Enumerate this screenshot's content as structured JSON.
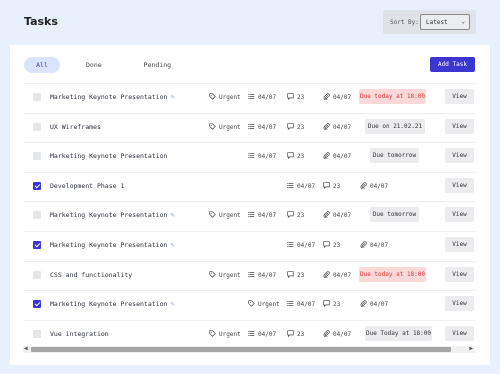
{
  "header": {
    "title": "Tasks",
    "sort_label": "Sort By:",
    "sort_value": "Latest"
  },
  "tabs": [
    {
      "label": "All",
      "active": true
    },
    {
      "label": "Done",
      "active": false
    },
    {
      "label": "Pending",
      "active": false
    }
  ],
  "add_button": "Add Task",
  "view_label": "View",
  "rows": [
    {
      "title": "Marketing Keynote Presentation",
      "edit": true,
      "checked": false,
      "tag": "Urgent",
      "date": "04/07",
      "comments": "23",
      "attach_date": "04/07",
      "status": "Due today at 18:00",
      "status_type": "red",
      "layout": "a"
    },
    {
      "title": "UX Wireframes",
      "edit": false,
      "checked": false,
      "tag": "Urgent",
      "date": "04/07",
      "comments": "23",
      "attach_date": "04/07",
      "status": "Due on 21.02.21",
      "status_type": "gray",
      "layout": "a"
    },
    {
      "title": "Marketing Keynote Presentation",
      "edit": false,
      "checked": false,
      "tag": "",
      "date": "04/07",
      "comments": "23",
      "attach_date": "04/07",
      "status": "Due tomorrow",
      "status_type": "gray",
      "layout": "a"
    },
    {
      "title": "Development Phase 1",
      "edit": false,
      "checked": true,
      "tag": "",
      "date": "04/07",
      "comments": "23",
      "attach_date": "04/07",
      "status": "",
      "status_type": "",
      "layout": "b"
    },
    {
      "title": "Marketing Keynote Presentation",
      "edit": true,
      "checked": false,
      "tag": "Urgent",
      "date": "04/07",
      "comments": "23",
      "attach_date": "04/07",
      "status": "Due tomorrow",
      "status_type": "gray",
      "layout": "a"
    },
    {
      "title": "Marketing Keynote Presentation",
      "edit": true,
      "checked": true,
      "tag": "",
      "date": "04/07",
      "comments": "23",
      "attach_date": "04/07",
      "status": "",
      "status_type": "",
      "layout": "b"
    },
    {
      "title": "CSS and functionality",
      "edit": false,
      "checked": false,
      "tag": "Urgent",
      "date": "04/07",
      "comments": "23",
      "attach_date": "04/07",
      "status": "Due today at 18:00",
      "status_type": "red",
      "layout": "a"
    },
    {
      "title": "Marketing Keynote Presentation",
      "edit": true,
      "checked": true,
      "tag": "Urgent",
      "date": "04/07",
      "comments": "23",
      "attach_date": "04/07",
      "status": "",
      "status_type": "",
      "layout": "b"
    },
    {
      "title": "Vue integration",
      "edit": false,
      "checked": false,
      "tag": "Urgent",
      "date": "04/07",
      "comments": "23",
      "attach_date": "04/07",
      "status": "Due Today at 18:00",
      "status_type": "gray",
      "layout": "a"
    }
  ],
  "colors": {
    "accent": "#3b36cf",
    "red_bg": "#fcd9d9",
    "red_text": "#d43a3a"
  }
}
